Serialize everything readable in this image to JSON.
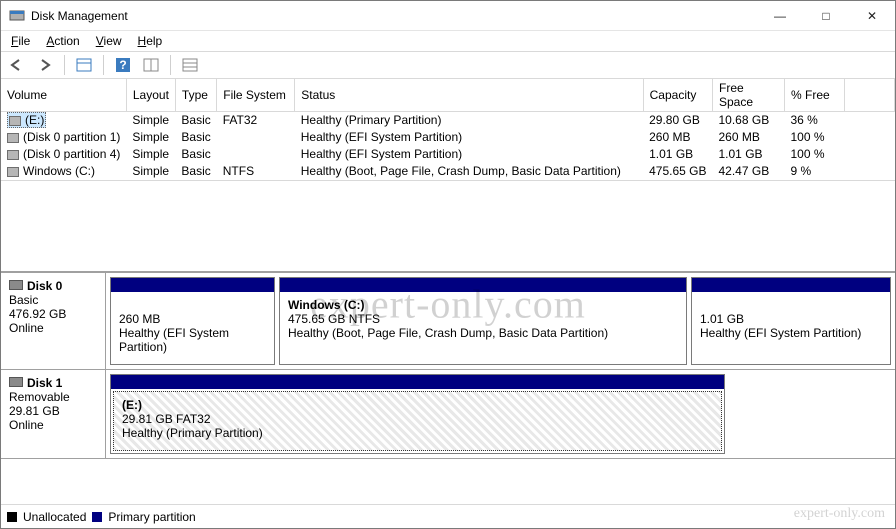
{
  "window": {
    "title": "Disk Management",
    "buttons": {
      "minimize": "—",
      "maximize": "□",
      "close": "✕"
    }
  },
  "menu": {
    "file": "File",
    "action": "Action",
    "view": "View",
    "help": "Help"
  },
  "columns": {
    "volume": "Volume",
    "layout": "Layout",
    "type": "Type",
    "fs": "File System",
    "status": "Status",
    "capacity": "Capacity",
    "free": "Free Space",
    "pctfree": "% Free"
  },
  "volumes": [
    {
      "name": "(E:)",
      "layout": "Simple",
      "type": "Basic",
      "fs": "FAT32",
      "status": "Healthy (Primary Partition)",
      "capacity": "29.80 GB",
      "free": "10.68 GB",
      "pctfree": "36 %"
    },
    {
      "name": "(Disk 0 partition 1)",
      "layout": "Simple",
      "type": "Basic",
      "fs": "",
      "status": "Healthy (EFI System Partition)",
      "capacity": "260 MB",
      "free": "260 MB",
      "pctfree": "100 %"
    },
    {
      "name": "(Disk 0 partition 4)",
      "layout": "Simple",
      "type": "Basic",
      "fs": "",
      "status": "Healthy (EFI System Partition)",
      "capacity": "1.01 GB",
      "free": "1.01 GB",
      "pctfree": "100 %"
    },
    {
      "name": "Windows  (C:)",
      "layout": "Simple",
      "type": "Basic",
      "fs": "NTFS",
      "status": "Healthy (Boot, Page File, Crash Dump, Basic Data Partition)",
      "capacity": "475.65 GB",
      "free": "42.47 GB",
      "pctfree": "9 %"
    }
  ],
  "disks": [
    {
      "name": "Disk 0",
      "type": "Basic",
      "size": "476.92 GB",
      "state": "Online",
      "parts": [
        {
          "title": "",
          "line2": "260 MB",
          "line3": "Healthy (EFI System Partition)",
          "flex": "0 0 165px"
        },
        {
          "title": "Windows  (C:)",
          "line2": "475.65 GB NTFS",
          "line3": "Healthy (Boot, Page File, Crash Dump, Basic Data Partition)",
          "flex": "1 1 auto"
        },
        {
          "title": "",
          "line2": "1.01 GB",
          "line3": "Healthy (EFI System Partition)",
          "flex": "0 0 200px"
        }
      ]
    },
    {
      "name": "Disk 1",
      "type": "Removable",
      "size": "29.81 GB",
      "state": "Online",
      "parts": [
        {
          "title": "(E:)",
          "line2": "29.81 GB FAT32",
          "line3": "Healthy (Primary Partition)",
          "flex": "0 0 615px",
          "hatched": true
        }
      ]
    }
  ],
  "legend": {
    "unallocated": "Unallocated",
    "primary": "Primary partition"
  },
  "watermark": "expert-only.com"
}
